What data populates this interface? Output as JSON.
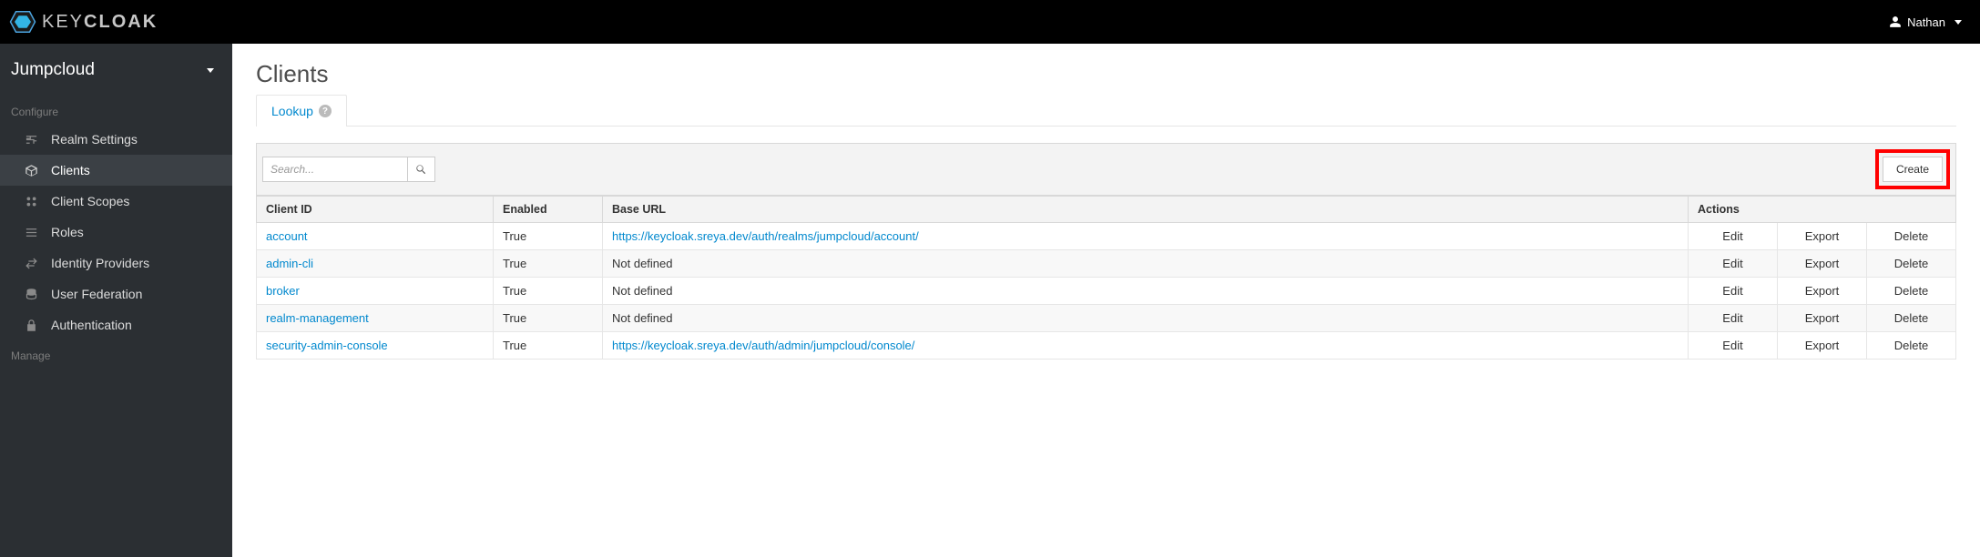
{
  "header": {
    "brand": "KEYCLOAK",
    "user": "Nathan"
  },
  "sidebar": {
    "realm": "Jumpcloud",
    "sections": [
      {
        "label": "Configure",
        "items": [
          {
            "key": "realm-settings",
            "label": "Realm Settings",
            "icon": "sliders-icon",
            "active": false
          },
          {
            "key": "clients",
            "label": "Clients",
            "icon": "cube-icon",
            "active": true
          },
          {
            "key": "client-scopes",
            "label": "Client Scopes",
            "icon": "scopes-icon",
            "active": false
          },
          {
            "key": "roles",
            "label": "Roles",
            "icon": "list-icon",
            "active": false
          },
          {
            "key": "identity-providers",
            "label": "Identity Providers",
            "icon": "exchange-icon",
            "active": false
          },
          {
            "key": "user-federation",
            "label": "User Federation",
            "icon": "database-icon",
            "active": false
          },
          {
            "key": "authentication",
            "label": "Authentication",
            "icon": "lock-icon",
            "active": false
          }
        ]
      },
      {
        "label": "Manage",
        "items": []
      }
    ]
  },
  "page": {
    "title": "Clients",
    "tab": "Lookup",
    "searchPlaceholder": "Search...",
    "createLabel": "Create",
    "columns": {
      "clientId": "Client ID",
      "enabled": "Enabled",
      "baseUrl": "Base URL",
      "actions": "Actions"
    },
    "actions": {
      "edit": "Edit",
      "export": "Export",
      "delete": "Delete"
    },
    "notDefined": "Not defined",
    "rows": [
      {
        "clientId": "account",
        "enabled": "True",
        "baseUrl": "https://keycloak.sreya.dev/auth/realms/jumpcloud/account/",
        "baseUrlDefined": true
      },
      {
        "clientId": "admin-cli",
        "enabled": "True",
        "baseUrl": null,
        "baseUrlDefined": false
      },
      {
        "clientId": "broker",
        "enabled": "True",
        "baseUrl": null,
        "baseUrlDefined": false
      },
      {
        "clientId": "realm-management",
        "enabled": "True",
        "baseUrl": null,
        "baseUrlDefined": false
      },
      {
        "clientId": "security-admin-console",
        "enabled": "True",
        "baseUrl": "https://keycloak.sreya.dev/auth/admin/jumpcloud/console/",
        "baseUrlDefined": true
      }
    ]
  }
}
